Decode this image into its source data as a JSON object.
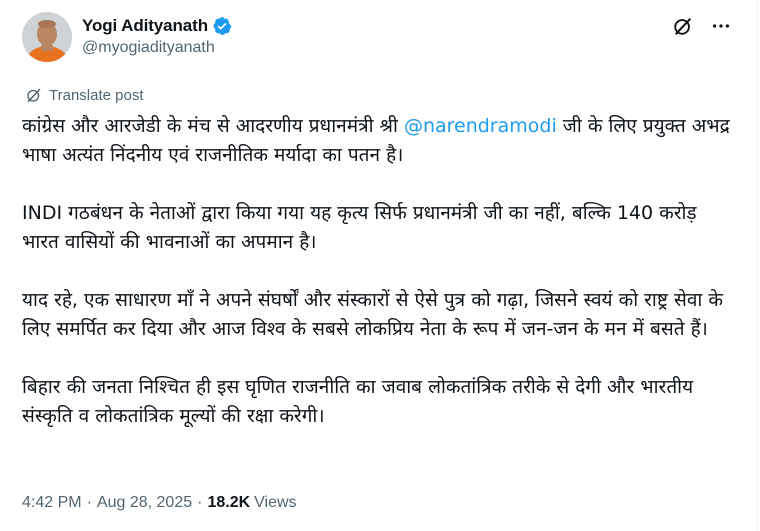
{
  "author": {
    "display_name": "Yogi Adityanath",
    "handle": "@myogiadityanath",
    "verified_color": "#1d9bf0"
  },
  "header_actions": {
    "grok_icon": "grok-icon",
    "more_icon": "more-options-icon"
  },
  "translate": {
    "label": "Translate post",
    "icon": "translate-icon"
  },
  "post": {
    "p1_before": "कांग्रेस और आरजेडी के मंच से आदरणीय प्रधानमंत्री श्री ",
    "p1_mention": "@narendramodi",
    "p1_after": " जी के लिए प्रयुक्त अभद्र भाषा अत्यंत निंदनीय एवं राजनीतिक मर्यादा का पतन है।",
    "p2": "INDI गठबंधन के नेताओं द्वारा किया गया यह कृत्य सिर्फ प्रधानमंत्री जी का नहीं, बल्कि 140 करोड़ भारत वासियों की भावनाओं का अपमान है।",
    "p3": "याद रहे, एक साधारण माँ ने अपने संघर्षों और संस्कारों से ऐसे पुत्र को गढ़ा, जिसने स्वयं को राष्ट्र सेवा के लिए समर्पित कर दिया और आज विश्व के सबसे लोकप्रिय नेता के रूप में जन-जन के मन में बसते हैं।",
    "p4": "बिहार की जनता निश्चित ही इस घृणित राजनीति का जवाब लोकतांत्रिक तरीके से देगी और भारतीय संस्कृति व लोकतांत्रिक मूल्यों की रक्षा करेगी।"
  },
  "meta": {
    "time": "4:42 PM",
    "separator": "·",
    "date": "Aug 28, 2025",
    "views_count": "18.2K",
    "views_label": "Views"
  },
  "colors": {
    "link": "#1d9bf0",
    "secondary": "#536471",
    "primary_text": "#0f1419"
  }
}
